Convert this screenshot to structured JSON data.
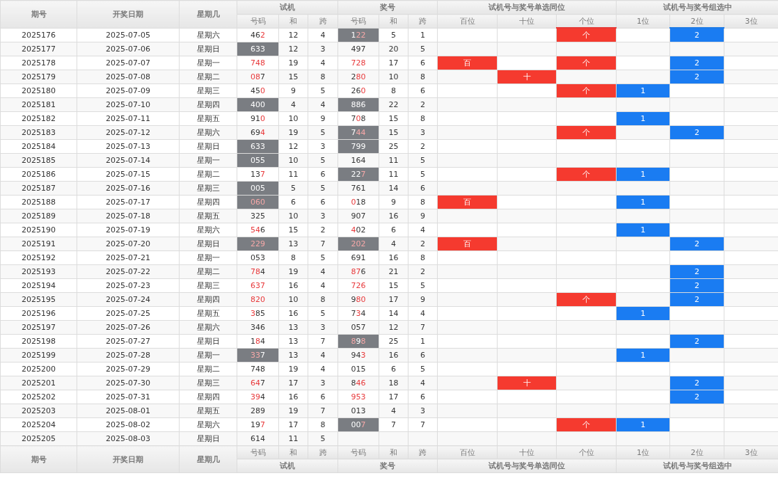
{
  "header": {
    "issue": "期号",
    "date": "开奖日期",
    "weekday": "星期几",
    "groups": [
      {
        "title": "试机",
        "columns": [
          "号码",
          "和",
          "跨"
        ]
      },
      {
        "title": "奖号",
        "columns": [
          "号码",
          "和",
          "跨"
        ]
      },
      {
        "title": "试机号与奖号单选同位",
        "columns": [
          "百位",
          "十位",
          "个位"
        ]
      },
      {
        "title": "试机号与奖号组选中",
        "columns": [
          "1位",
          "2位",
          "3位"
        ]
      }
    ]
  },
  "rows": [
    {
      "issue": "2025176",
      "date": "2025-07-05",
      "weekday": "星期六",
      "test": {
        "number": "462",
        "red_digits": [
          false,
          false,
          true
        ],
        "highlighted": false,
        "sum": "12",
        "span": "4"
      },
      "draw": {
        "number": "122",
        "red_digits": [
          false,
          true,
          true
        ],
        "highlighted": true,
        "sum": "5",
        "span": "1"
      },
      "same_position": {
        "units": "个"
      },
      "group_hits": {
        "second": "2"
      }
    },
    {
      "issue": "2025177",
      "date": "2025-07-06",
      "weekday": "星期日",
      "test": {
        "number": "633",
        "red_digits": [
          false,
          false,
          false
        ],
        "highlighted": true,
        "sum": "12",
        "span": "3"
      },
      "draw": {
        "number": "497",
        "red_digits": [
          false,
          false,
          false
        ],
        "highlighted": false,
        "sum": "20",
        "span": "5"
      },
      "same_position": {},
      "group_hits": {}
    },
    {
      "issue": "2025178",
      "date": "2025-07-07",
      "weekday": "星期一",
      "test": {
        "number": "748",
        "red_digits": [
          true,
          true,
          true
        ],
        "highlighted": false,
        "sum": "19",
        "span": "4"
      },
      "draw": {
        "number": "728",
        "red_digits": [
          true,
          true,
          true
        ],
        "highlighted": false,
        "sum": "17",
        "span": "6"
      },
      "same_position": {
        "hundreds": "百",
        "units": "个"
      },
      "group_hits": {
        "second": "2"
      }
    },
    {
      "issue": "2025179",
      "date": "2025-07-08",
      "weekday": "星期二",
      "test": {
        "number": "087",
        "red_digits": [
          true,
          true,
          false
        ],
        "highlighted": false,
        "sum": "15",
        "span": "8"
      },
      "draw": {
        "number": "280",
        "red_digits": [
          false,
          true,
          true
        ],
        "highlighted": false,
        "sum": "10",
        "span": "8"
      },
      "same_position": {
        "tens": "十"
      },
      "group_hits": {
        "second": "2"
      }
    },
    {
      "issue": "2025180",
      "date": "2025-07-09",
      "weekday": "星期三",
      "test": {
        "number": "450",
        "red_digits": [
          false,
          false,
          true
        ],
        "highlighted": false,
        "sum": "9",
        "span": "5"
      },
      "draw": {
        "number": "260",
        "red_digits": [
          false,
          false,
          true
        ],
        "highlighted": false,
        "sum": "8",
        "span": "6"
      },
      "same_position": {
        "units": "个"
      },
      "group_hits": {
        "first": "1"
      }
    },
    {
      "issue": "2025181",
      "date": "2025-07-10",
      "weekday": "星期四",
      "test": {
        "number": "400",
        "red_digits": [
          false,
          false,
          false
        ],
        "highlighted": true,
        "sum": "4",
        "span": "4"
      },
      "draw": {
        "number": "886",
        "red_digits": [
          false,
          false,
          false
        ],
        "highlighted": true,
        "sum": "22",
        "span": "2"
      },
      "same_position": {},
      "group_hits": {}
    },
    {
      "issue": "2025182",
      "date": "2025-07-11",
      "weekday": "星期五",
      "test": {
        "number": "910",
        "red_digits": [
          false,
          false,
          true
        ],
        "highlighted": false,
        "sum": "10",
        "span": "9"
      },
      "draw": {
        "number": "708",
        "red_digits": [
          false,
          true,
          false
        ],
        "highlighted": false,
        "sum": "15",
        "span": "8"
      },
      "same_position": {},
      "group_hits": {
        "first": "1"
      }
    },
    {
      "issue": "2025183",
      "date": "2025-07-12",
      "weekday": "星期六",
      "test": {
        "number": "694",
        "red_digits": [
          false,
          false,
          true
        ],
        "highlighted": false,
        "sum": "19",
        "span": "5"
      },
      "draw": {
        "number": "744",
        "red_digits": [
          false,
          true,
          true
        ],
        "highlighted": true,
        "sum": "15",
        "span": "3"
      },
      "same_position": {
        "units": "个"
      },
      "group_hits": {
        "second": "2"
      }
    },
    {
      "issue": "2025184",
      "date": "2025-07-13",
      "weekday": "星期日",
      "test": {
        "number": "633",
        "red_digits": [
          false,
          false,
          false
        ],
        "highlighted": true,
        "sum": "12",
        "span": "3"
      },
      "draw": {
        "number": "799",
        "red_digits": [
          false,
          false,
          false
        ],
        "highlighted": true,
        "sum": "25",
        "span": "2"
      },
      "same_position": {},
      "group_hits": {}
    },
    {
      "issue": "2025185",
      "date": "2025-07-14",
      "weekday": "星期一",
      "test": {
        "number": "055",
        "red_digits": [
          false,
          false,
          false
        ],
        "highlighted": true,
        "sum": "10",
        "span": "5"
      },
      "draw": {
        "number": "164",
        "red_digits": [
          false,
          false,
          false
        ],
        "highlighted": false,
        "sum": "11",
        "span": "5"
      },
      "same_position": {},
      "group_hits": {}
    },
    {
      "issue": "2025186",
      "date": "2025-07-15",
      "weekday": "星期二",
      "test": {
        "number": "137",
        "red_digits": [
          false,
          false,
          true
        ],
        "highlighted": false,
        "sum": "11",
        "span": "6"
      },
      "draw": {
        "number": "227",
        "red_digits": [
          false,
          false,
          true
        ],
        "highlighted": true,
        "sum": "11",
        "span": "5"
      },
      "same_position": {
        "units": "个"
      },
      "group_hits": {
        "first": "1"
      }
    },
    {
      "issue": "2025187",
      "date": "2025-07-16",
      "weekday": "星期三",
      "test": {
        "number": "005",
        "red_digits": [
          false,
          false,
          false
        ],
        "highlighted": true,
        "sum": "5",
        "span": "5"
      },
      "draw": {
        "number": "761",
        "red_digits": [
          false,
          false,
          false
        ],
        "highlighted": false,
        "sum": "14",
        "span": "6"
      },
      "same_position": {},
      "group_hits": {}
    },
    {
      "issue": "2025188",
      "date": "2025-07-17",
      "weekday": "星期四",
      "test": {
        "number": "060",
        "red_digits": [
          true,
          true,
          true
        ],
        "highlighted": true,
        "sum": "6",
        "span": "6"
      },
      "draw": {
        "number": "018",
        "red_digits": [
          true,
          false,
          false
        ],
        "highlighted": false,
        "sum": "9",
        "span": "8"
      },
      "same_position": {
        "hundreds": "百"
      },
      "group_hits": {
        "first": "1"
      }
    },
    {
      "issue": "2025189",
      "date": "2025-07-18",
      "weekday": "星期五",
      "test": {
        "number": "325",
        "red_digits": [
          false,
          false,
          false
        ],
        "highlighted": false,
        "sum": "10",
        "span": "3"
      },
      "draw": {
        "number": "907",
        "red_digits": [
          false,
          false,
          false
        ],
        "highlighted": false,
        "sum": "16",
        "span": "9"
      },
      "same_position": {},
      "group_hits": {}
    },
    {
      "issue": "2025190",
      "date": "2025-07-19",
      "weekday": "星期六",
      "test": {
        "number": "546",
        "red_digits": [
          true,
          true,
          false
        ],
        "highlighted": false,
        "sum": "15",
        "span": "2"
      },
      "draw": {
        "number": "402",
        "red_digits": [
          true,
          false,
          false
        ],
        "highlighted": false,
        "sum": "6",
        "span": "4"
      },
      "same_position": {},
      "group_hits": {
        "first": "1"
      }
    },
    {
      "issue": "2025191",
      "date": "2025-07-20",
      "weekday": "星期日",
      "test": {
        "number": "229",
        "red_digits": [
          true,
          true,
          true
        ],
        "highlighted": true,
        "sum": "13",
        "span": "7"
      },
      "draw": {
        "number": "202",
        "red_digits": [
          true,
          true,
          true
        ],
        "highlighted": true,
        "sum": "4",
        "span": "2"
      },
      "same_position": {
        "hundreds": "百"
      },
      "group_hits": {
        "second": "2"
      }
    },
    {
      "issue": "2025192",
      "date": "2025-07-21",
      "weekday": "星期一",
      "test": {
        "number": "053",
        "red_digits": [
          false,
          false,
          false
        ],
        "highlighted": false,
        "sum": "8",
        "span": "5"
      },
      "draw": {
        "number": "691",
        "red_digits": [
          false,
          false,
          false
        ],
        "highlighted": false,
        "sum": "16",
        "span": "8"
      },
      "same_position": {},
      "group_hits": {}
    },
    {
      "issue": "2025193",
      "date": "2025-07-22",
      "weekday": "星期二",
      "test": {
        "number": "784",
        "red_digits": [
          true,
          true,
          false
        ],
        "highlighted": false,
        "sum": "19",
        "span": "4"
      },
      "draw": {
        "number": "876",
        "red_digits": [
          true,
          true,
          false
        ],
        "highlighted": false,
        "sum": "21",
        "span": "2"
      },
      "same_position": {},
      "group_hits": {
        "second": "2"
      }
    },
    {
      "issue": "2025194",
      "date": "2025-07-23",
      "weekday": "星期三",
      "test": {
        "number": "637",
        "red_digits": [
          true,
          true,
          true
        ],
        "highlighted": false,
        "sum": "16",
        "span": "4"
      },
      "draw": {
        "number": "726",
        "red_digits": [
          true,
          true,
          true
        ],
        "highlighted": false,
        "sum": "15",
        "span": "5"
      },
      "same_position": {},
      "group_hits": {
        "second": "2"
      }
    },
    {
      "issue": "2025195",
      "date": "2025-07-24",
      "weekday": "星期四",
      "test": {
        "number": "820",
        "red_digits": [
          true,
          true,
          true
        ],
        "highlighted": false,
        "sum": "10",
        "span": "8"
      },
      "draw": {
        "number": "980",
        "red_digits": [
          false,
          true,
          true
        ],
        "highlighted": false,
        "sum": "17",
        "span": "9"
      },
      "same_position": {
        "units": "个"
      },
      "group_hits": {
        "second": "2"
      }
    },
    {
      "issue": "2025196",
      "date": "2025-07-25",
      "weekday": "星期五",
      "test": {
        "number": "385",
        "red_digits": [
          true,
          false,
          false
        ],
        "highlighted": false,
        "sum": "16",
        "span": "5"
      },
      "draw": {
        "number": "734",
        "red_digits": [
          false,
          true,
          false
        ],
        "highlighted": false,
        "sum": "14",
        "span": "4"
      },
      "same_position": {},
      "group_hits": {
        "first": "1"
      }
    },
    {
      "issue": "2025197",
      "date": "2025-07-26",
      "weekday": "星期六",
      "test": {
        "number": "346",
        "red_digits": [
          false,
          false,
          false
        ],
        "highlighted": false,
        "sum": "13",
        "span": "3"
      },
      "draw": {
        "number": "057",
        "red_digits": [
          false,
          false,
          false
        ],
        "highlighted": false,
        "sum": "12",
        "span": "7"
      },
      "same_position": {},
      "group_hits": {}
    },
    {
      "issue": "2025198",
      "date": "2025-07-27",
      "weekday": "星期日",
      "test": {
        "number": "184",
        "red_digits": [
          false,
          true,
          false
        ],
        "highlighted": false,
        "sum": "13",
        "span": "7"
      },
      "draw": {
        "number": "898",
        "red_digits": [
          true,
          false,
          true
        ],
        "highlighted": true,
        "sum": "25",
        "span": "1"
      },
      "same_position": {},
      "group_hits": {
        "second": "2"
      }
    },
    {
      "issue": "2025199",
      "date": "2025-07-28",
      "weekday": "星期一",
      "test": {
        "number": "337",
        "red_digits": [
          true,
          true,
          false
        ],
        "highlighted": true,
        "sum": "13",
        "span": "4"
      },
      "draw": {
        "number": "943",
        "red_digits": [
          false,
          false,
          true
        ],
        "highlighted": false,
        "sum": "16",
        "span": "6"
      },
      "same_position": {},
      "group_hits": {
        "first": "1"
      }
    },
    {
      "issue": "2025200",
      "date": "2025-07-29",
      "weekday": "星期二",
      "test": {
        "number": "748",
        "red_digits": [
          false,
          false,
          false
        ],
        "highlighted": false,
        "sum": "19",
        "span": "4"
      },
      "draw": {
        "number": "015",
        "red_digits": [
          false,
          false,
          false
        ],
        "highlighted": false,
        "sum": "6",
        "span": "5"
      },
      "same_position": {},
      "group_hits": {}
    },
    {
      "issue": "2025201",
      "date": "2025-07-30",
      "weekday": "星期三",
      "test": {
        "number": "647",
        "red_digits": [
          true,
          true,
          false
        ],
        "highlighted": false,
        "sum": "17",
        "span": "3"
      },
      "draw": {
        "number": "846",
        "red_digits": [
          false,
          true,
          true
        ],
        "highlighted": false,
        "sum": "18",
        "span": "4"
      },
      "same_position": {
        "tens": "十"
      },
      "group_hits": {
        "second": "2"
      }
    },
    {
      "issue": "2025202",
      "date": "2025-07-31",
      "weekday": "星期四",
      "test": {
        "number": "394",
        "red_digits": [
          true,
          true,
          false
        ],
        "highlighted": false,
        "sum": "16",
        "span": "6"
      },
      "draw": {
        "number": "953",
        "red_digits": [
          true,
          true,
          true
        ],
        "highlighted": false,
        "sum": "17",
        "span": "6"
      },
      "same_position": {},
      "group_hits": {
        "second": "2"
      }
    },
    {
      "issue": "2025203",
      "date": "2025-08-01",
      "weekday": "星期五",
      "test": {
        "number": "289",
        "red_digits": [
          false,
          false,
          false
        ],
        "highlighted": false,
        "sum": "19",
        "span": "7"
      },
      "draw": {
        "number": "013",
        "red_digits": [
          false,
          false,
          false
        ],
        "highlighted": false,
        "sum": "4",
        "span": "3"
      },
      "same_position": {},
      "group_hits": {}
    },
    {
      "issue": "2025204",
      "date": "2025-08-02",
      "weekday": "星期六",
      "test": {
        "number": "197",
        "red_digits": [
          false,
          false,
          true
        ],
        "highlighted": false,
        "sum": "17",
        "span": "8"
      },
      "draw": {
        "number": "007",
        "red_digits": [
          false,
          false,
          true
        ],
        "highlighted": true,
        "sum": "7",
        "span": "7"
      },
      "same_position": {
        "units": "个"
      },
      "group_hits": {
        "first": "1"
      }
    },
    {
      "issue": "2025205",
      "date": "2025-08-03",
      "weekday": "星期日",
      "test": {
        "number": "614",
        "red_digits": [
          false,
          false,
          false
        ],
        "highlighted": false,
        "sum": "11",
        "span": "5"
      },
      "draw": null
    }
  ],
  "footer": {
    "issue": "期号",
    "date": "开奖日期",
    "weekday": "星期几",
    "groups": [
      {
        "title": "试机",
        "columns": [
          "号码",
          "和",
          "跨"
        ]
      },
      {
        "title": "奖号",
        "columns": [
          "号码",
          "和",
          "跨"
        ]
      },
      {
        "title": "试机号与奖号单选同位",
        "columns": [
          "百位",
          "十位",
          "个位"
        ]
      },
      {
        "title": "试机号与奖号组选中",
        "columns": [
          "1位",
          "2位",
          "3位"
        ]
      }
    ]
  }
}
